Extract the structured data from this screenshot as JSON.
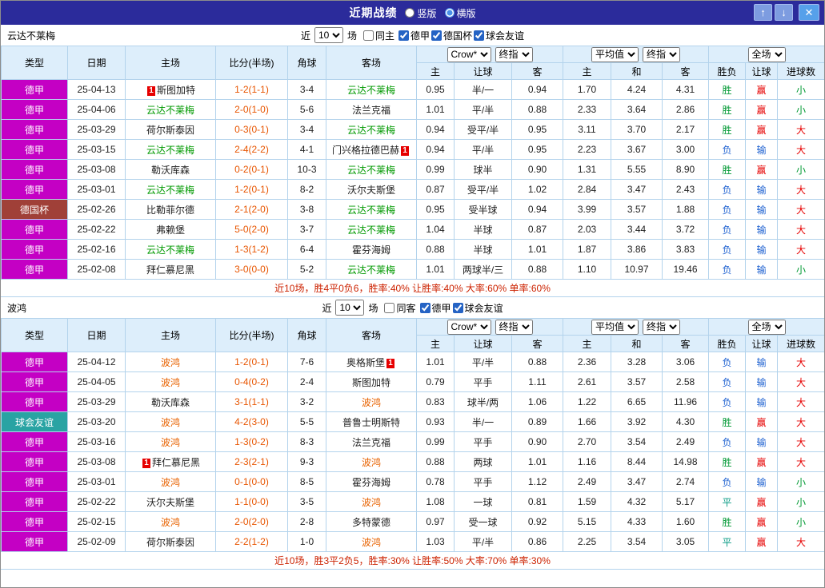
{
  "titlebar": {
    "title": "近期战绩",
    "radios": [
      {
        "label": "竖版",
        "selected": false
      },
      {
        "label": "横版",
        "selected": true
      }
    ],
    "buttons": {
      "up": "↑",
      "down": "↓",
      "close": "✕"
    }
  },
  "type_colors": {
    "德甲": "#c400c4",
    "德国杯": "#a04038",
    "球会友谊": "#29a3a3"
  },
  "result_colors": {
    "胜": "#009933",
    "平": "#0a9b85",
    "负": "#1b5fd0",
    "赢": "#e60000",
    "输": "#1b5fd0",
    "大": "#e60000",
    "小": "#009933"
  },
  "header": {
    "cols": [
      "类型",
      "日期",
      "主场",
      "比分(半场)",
      "角球",
      "客场"
    ],
    "group1": [
      "Crow*",
      "终指"
    ],
    "group2": [
      "平均值",
      "终指"
    ],
    "group3": [
      "全场"
    ],
    "sub": [
      "主",
      "让球",
      "客",
      "主",
      "和",
      "客",
      "胜负",
      "让球",
      "进球数"
    ]
  },
  "sections": [
    {
      "team": "云达不莱梅",
      "team_color": "#009900",
      "filter": {
        "prefix": "近",
        "count": "10",
        "suffix": "场",
        "venue": {
          "label": "同主",
          "checked": false
        },
        "leagues": [
          {
            "label": "德甲",
            "checked": true
          },
          {
            "label": "德国杯",
            "checked": true
          },
          {
            "label": "球会友谊",
            "checked": true
          }
        ]
      },
      "rows": [
        {
          "type": "德甲",
          "date": "25-04-13",
          "home": {
            "name": "斯图加特",
            "badge": "1",
            "badge_pos": "before"
          },
          "score": "1-2(1-1)",
          "corner": "3-4",
          "away": {
            "name": "云达不莱梅",
            "self": true
          },
          "odds": [
            "0.95",
            "半/一",
            "0.94"
          ],
          "avg": [
            "1.70",
            "4.24",
            "4.31"
          ],
          "result": [
            "胜",
            "赢",
            "小"
          ]
        },
        {
          "type": "德甲",
          "date": "25-04-06",
          "home": {
            "name": "云达不莱梅",
            "self": true
          },
          "score": "2-0(1-0)",
          "corner": "5-6",
          "away": {
            "name": "法兰克福"
          },
          "odds": [
            "1.01",
            "平/半",
            "0.88"
          ],
          "avg": [
            "2.33",
            "3.64",
            "2.86"
          ],
          "result": [
            "胜",
            "赢",
            "小"
          ]
        },
        {
          "type": "德甲",
          "date": "25-03-29",
          "home": {
            "name": "荷尔斯泰因"
          },
          "score": "0-3(0-1)",
          "corner": "3-4",
          "away": {
            "name": "云达不莱梅",
            "self": true
          },
          "odds": [
            "0.94",
            "受平/半",
            "0.95"
          ],
          "avg": [
            "3.11",
            "3.70",
            "2.17"
          ],
          "result": [
            "胜",
            "赢",
            "大"
          ]
        },
        {
          "type": "德甲",
          "date": "25-03-15",
          "home": {
            "name": "云达不莱梅",
            "self": true
          },
          "score": "2-4(2-2)",
          "corner": "4-1",
          "away": {
            "name": "门兴格拉德巴赫",
            "badge": "1",
            "badge_pos": "after"
          },
          "odds": [
            "0.94",
            "平/半",
            "0.95"
          ],
          "avg": [
            "2.23",
            "3.67",
            "3.00"
          ],
          "result": [
            "负",
            "输",
            "大"
          ]
        },
        {
          "type": "德甲",
          "date": "25-03-08",
          "home": {
            "name": "勒沃库森"
          },
          "score": "0-2(0-1)",
          "corner": "10-3",
          "away": {
            "name": "云达不莱梅",
            "self": true
          },
          "odds": [
            "0.99",
            "球半",
            "0.90"
          ],
          "avg": [
            "1.31",
            "5.55",
            "8.90"
          ],
          "result": [
            "胜",
            "赢",
            "小"
          ]
        },
        {
          "type": "德甲",
          "date": "25-03-01",
          "home": {
            "name": "云达不莱梅",
            "self": true
          },
          "score": "1-2(0-1)",
          "corner": "8-2",
          "away": {
            "name": "沃尔夫斯堡"
          },
          "odds": [
            "0.87",
            "受平/半",
            "1.02"
          ],
          "avg": [
            "2.84",
            "3.47",
            "2.43"
          ],
          "result": [
            "负",
            "输",
            "大"
          ]
        },
        {
          "type": "德国杯",
          "date": "25-02-26",
          "home": {
            "name": "比勒菲尔德"
          },
          "score": "2-1(2-0)",
          "corner": "3-8",
          "away": {
            "name": "云达不莱梅",
            "self": true
          },
          "odds": [
            "0.95",
            "受半球",
            "0.94"
          ],
          "avg": [
            "3.99",
            "3.57",
            "1.88"
          ],
          "result": [
            "负",
            "输",
            "大"
          ]
        },
        {
          "type": "德甲",
          "date": "25-02-22",
          "home": {
            "name": "弗赖堡"
          },
          "score": "5-0(2-0)",
          "corner": "3-7",
          "away": {
            "name": "云达不莱梅",
            "self": true
          },
          "odds": [
            "1.04",
            "半球",
            "0.87"
          ],
          "avg": [
            "2.03",
            "3.44",
            "3.72"
          ],
          "result": [
            "负",
            "输",
            "大"
          ]
        },
        {
          "type": "德甲",
          "date": "25-02-16",
          "home": {
            "name": "云达不莱梅",
            "self": true
          },
          "score": "1-3(1-2)",
          "corner": "6-4",
          "away": {
            "name": "霍芬海姆"
          },
          "odds": [
            "0.88",
            "半球",
            "1.01"
          ],
          "avg": [
            "1.87",
            "3.86",
            "3.83"
          ],
          "result": [
            "负",
            "输",
            "大"
          ]
        },
        {
          "type": "德甲",
          "date": "25-02-08",
          "home": {
            "name": "拜仁慕尼黑"
          },
          "score": "3-0(0-0)",
          "corner": "5-2",
          "away": {
            "name": "云达不莱梅",
            "self": true
          },
          "odds": [
            "1.01",
            "两球半/三",
            "0.88"
          ],
          "avg": [
            "1.10",
            "10.97",
            "19.46"
          ],
          "result": [
            "负",
            "输",
            "小"
          ]
        }
      ],
      "summary": "近10场，胜4平0负6，胜率:40% 让胜率:40% 大率:60% 单率:60%"
    },
    {
      "team": "波鸿",
      "team_color": "#e86200",
      "filter": {
        "prefix": "近",
        "count": "10",
        "suffix": "场",
        "venue": {
          "label": "同客",
          "checked": false
        },
        "leagues": [
          {
            "label": "德甲",
            "checked": true
          },
          {
            "label": "球会友谊",
            "checked": true
          }
        ]
      },
      "rows": [
        {
          "type": "德甲",
          "date": "25-04-12",
          "home": {
            "name": "波鸿",
            "self": true
          },
          "score": "1-2(0-1)",
          "corner": "7-6",
          "away": {
            "name": "奥格斯堡",
            "badge": "1",
            "badge_pos": "after"
          },
          "odds": [
            "1.01",
            "平/半",
            "0.88"
          ],
          "avg": [
            "2.36",
            "3.28",
            "3.06"
          ],
          "result": [
            "负",
            "输",
            "大"
          ]
        },
        {
          "type": "德甲",
          "date": "25-04-05",
          "home": {
            "name": "波鸿",
            "self": true
          },
          "score": "0-4(0-2)",
          "corner": "2-4",
          "away": {
            "name": "斯图加特"
          },
          "odds": [
            "0.79",
            "平手",
            "1.11"
          ],
          "avg": [
            "2.61",
            "3.57",
            "2.58"
          ],
          "result": [
            "负",
            "输",
            "大"
          ]
        },
        {
          "type": "德甲",
          "date": "25-03-29",
          "home": {
            "name": "勒沃库森"
          },
          "score": "3-1(1-1)",
          "corner": "3-2",
          "away": {
            "name": "波鸿",
            "self": true
          },
          "odds": [
            "0.83",
            "球半/两",
            "1.06"
          ],
          "avg": [
            "1.22",
            "6.65",
            "11.96"
          ],
          "result": [
            "负",
            "输",
            "大"
          ]
        },
        {
          "type": "球会友谊",
          "date": "25-03-20",
          "home": {
            "name": "波鸿",
            "self": true
          },
          "score": "4-2(3-0)",
          "corner": "5-5",
          "away": {
            "name": "普鲁士明斯特"
          },
          "odds": [
            "0.93",
            "半/一",
            "0.89"
          ],
          "avg": [
            "1.66",
            "3.92",
            "4.30"
          ],
          "result": [
            "胜",
            "赢",
            "大"
          ]
        },
        {
          "type": "德甲",
          "date": "25-03-16",
          "home": {
            "name": "波鸿",
            "self": true
          },
          "score": "1-3(0-2)",
          "corner": "8-3",
          "away": {
            "name": "法兰克福"
          },
          "odds": [
            "0.99",
            "平手",
            "0.90"
          ],
          "avg": [
            "2.70",
            "3.54",
            "2.49"
          ],
          "result": [
            "负",
            "输",
            "大"
          ]
        },
        {
          "type": "德甲",
          "date": "25-03-08",
          "home": {
            "name": "拜仁慕尼黑",
            "badge": "1",
            "badge_pos": "before"
          },
          "score": "2-3(2-1)",
          "corner": "9-3",
          "away": {
            "name": "波鸿",
            "self": true
          },
          "odds": [
            "0.88",
            "两球",
            "1.01"
          ],
          "avg": [
            "1.16",
            "8.44",
            "14.98"
          ],
          "result": [
            "胜",
            "赢",
            "大"
          ]
        },
        {
          "type": "德甲",
          "date": "25-03-01",
          "home": {
            "name": "波鸿",
            "self": true
          },
          "score": "0-1(0-0)",
          "corner": "8-5",
          "away": {
            "name": "霍芬海姆"
          },
          "odds": [
            "0.78",
            "平手",
            "1.12"
          ],
          "avg": [
            "2.49",
            "3.47",
            "2.74"
          ],
          "result": [
            "负",
            "输",
            "小"
          ]
        },
        {
          "type": "德甲",
          "date": "25-02-22",
          "home": {
            "name": "沃尔夫斯堡"
          },
          "score": "1-1(0-0)",
          "corner": "3-5",
          "away": {
            "name": "波鸿",
            "self": true
          },
          "odds": [
            "1.08",
            "一球",
            "0.81"
          ],
          "avg": [
            "1.59",
            "4.32",
            "5.17"
          ],
          "result": [
            "平",
            "赢",
            "小"
          ]
        },
        {
          "type": "德甲",
          "date": "25-02-15",
          "home": {
            "name": "波鸿",
            "self": true
          },
          "score": "2-0(2-0)",
          "corner": "2-8",
          "away": {
            "name": "多特蒙德"
          },
          "odds": [
            "0.97",
            "受一球",
            "0.92"
          ],
          "avg": [
            "5.15",
            "4.33",
            "1.60"
          ],
          "result": [
            "胜",
            "赢",
            "小"
          ]
        },
        {
          "type": "德甲",
          "date": "25-02-09",
          "home": {
            "name": "荷尔斯泰因"
          },
          "score": "2-2(1-2)",
          "corner": "1-0",
          "away": {
            "name": "波鸿",
            "self": true
          },
          "odds": [
            "1.03",
            "平/半",
            "0.86"
          ],
          "avg": [
            "2.25",
            "3.54",
            "3.05"
          ],
          "result": [
            "平",
            "赢",
            "大"
          ]
        }
      ],
      "summary": "近10场，胜3平2负5，胜率:30% 让胜率:50% 大率:70% 单率:30%"
    }
  ]
}
